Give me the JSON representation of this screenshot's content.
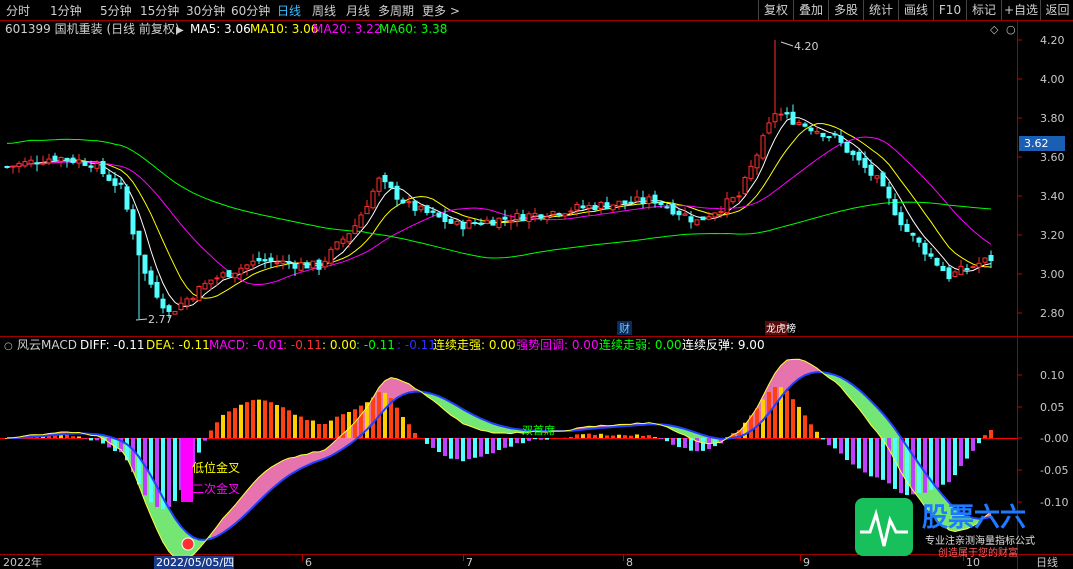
{
  "toolbar": {
    "periods": [
      "分时",
      "1分钟",
      "5分钟",
      "15分钟",
      "30分钟",
      "60分钟",
      "日线",
      "周线",
      "月线",
      "多周期",
      "更多 >"
    ],
    "active_period": "日线",
    "right_buttons": [
      "复权",
      "叠加",
      "多股",
      "统计",
      "画线",
      "F10",
      "标记",
      "+自选",
      "返回"
    ]
  },
  "main_panel": {
    "stock_title": "601399 国机重装 (日线 前复权)",
    "ma": [
      {
        "label": "MA5: 3.06",
        "color": "#ffffff"
      },
      {
        "label": "MA10: 3.06",
        "color": "#ffff00"
      },
      {
        "label": "MA20: 3.22",
        "color": "#ff00ff"
      },
      {
        "label": "MA60: 3.38",
        "color": "#00ff00"
      }
    ],
    "high_label": "4.20",
    "low_label": "2.77",
    "current_price": "3.62",
    "price_ticks": [
      "4.20",
      "4.00",
      "3.80",
      "3.60",
      "3.40",
      "3.20",
      "3.00",
      "2.80"
    ],
    "marker_cai": "财",
    "marker_bang": "龙虎榜"
  },
  "macd_panel": {
    "title": "风云MACD",
    "values": [
      {
        "label": "DIFF: -0.11",
        "color": "#ffffff"
      },
      {
        "label": "DEA: -0.11",
        "color": "#ffff00"
      },
      {
        "label": "MACD: -0.01",
        "color": "#ff00ff"
      },
      {
        "label": ": -0.11",
        "color": "#ff3030"
      },
      {
        "label": ": 0.00",
        "color": "#ffff00"
      },
      {
        "label": ": -0.11",
        "color": "#00ff00"
      },
      {
        "label": ": -0.11",
        "color": "#3030ff"
      },
      {
        "label": "连续走强: 0.00",
        "color": "#ffff00"
      },
      {
        "label": "强势回调: 0.00",
        "color": "#ff00ff"
      },
      {
        "label": "连续走弱: 0.00",
        "color": "#00ff00"
      },
      {
        "label": "连续反弹: 9.00",
        "color": "#ffffff"
      }
    ],
    "ticks": [
      "0.10",
      "0.05",
      "-0.00",
      "-0.05",
      "-0.10"
    ],
    "annotation_low": "低位金叉",
    "annotation_second": "二次金叉",
    "annotation_green": "双首席"
  },
  "time_axis": {
    "labels": [
      "2022年",
      "2022/05/05/四",
      "6",
      "7",
      "8",
      "9",
      "10"
    ],
    "period": "日线"
  },
  "watermark": {
    "brand": "股票六六",
    "line1": "专业注亲测海量指标公式",
    "line2": "创造属于您的财富"
  },
  "colors": {
    "up": "#ff3030",
    "down": "#54ffff",
    "ma5": "#ffffff",
    "ma10": "#ffff00",
    "ma20": "#ff00ff",
    "ma60": "#00ff00",
    "axis": "#c00000"
  }
}
